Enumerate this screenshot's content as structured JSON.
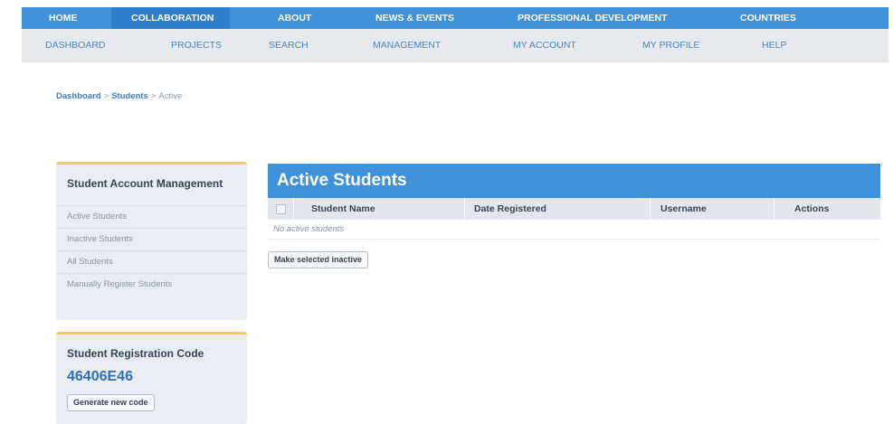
{
  "top_nav": {
    "items": [
      {
        "label": "HOME"
      },
      {
        "label": "COLLABORATION"
      },
      {
        "label": "ABOUT"
      },
      {
        "label": "NEWS & EVENTS"
      },
      {
        "label": "PROFESSIONAL DEVELOPMENT"
      },
      {
        "label": "COUNTRIES"
      }
    ],
    "active": "COLLABORATION"
  },
  "sub_nav": {
    "items": [
      {
        "label": "DASHBOARD"
      },
      {
        "label": "PROJECTS"
      },
      {
        "label": "SEARCH"
      },
      {
        "label": "MANAGEMENT"
      },
      {
        "label": "MY ACCOUNT"
      },
      {
        "label": "MY PROFILE"
      },
      {
        "label": "HELP"
      }
    ]
  },
  "breadcrumb": {
    "items": [
      "Dashboard",
      "Students",
      "Active"
    ],
    "separator": ">"
  },
  "sidebar": {
    "account_panel": {
      "title": "Student Account Management",
      "links": [
        "Active Students",
        "Inactive Students",
        "All Students",
        "Manually Register Students"
      ]
    },
    "code_panel": {
      "title": "Student Registration Code",
      "code": "46406E46",
      "button_label": "Generate new code"
    }
  },
  "main": {
    "title": "Active Students",
    "table": {
      "columns": [
        "Student Name",
        "Date Registered",
        "Username",
        "Actions"
      ],
      "empty_message": "No active students"
    },
    "action_button_label": "Make selected inactive"
  },
  "colors": {
    "nav_blue": "#3f92da",
    "nav_active": "#2f80cc",
    "panel_accent": "#f2cf51",
    "link_blue": "#4a86c8"
  },
  "icons": {
    "select_all": "checkbox-icon"
  }
}
